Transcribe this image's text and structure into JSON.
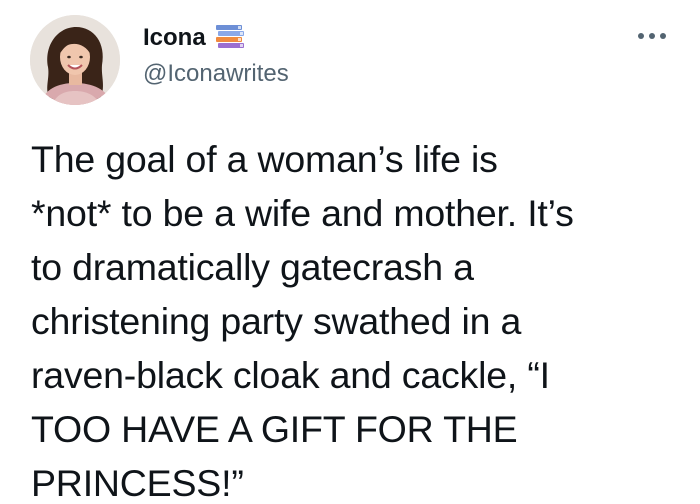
{
  "author": {
    "display_name": "Icona",
    "handle": "@Iconawrites",
    "name_badge_icon": "books-stack-icon",
    "avatar_icon": "profile-photo"
  },
  "menu": {
    "icon": "more-horizontal-icon"
  },
  "tweet": {
    "lines": [
      "The goal of a woman’s life is",
      "*not* to be a wife and mother. It’s",
      "to dramatically gatecrash a",
      "christening party swathed in a",
      "raven-black cloak and cackle, “I",
      "TOO HAVE A GIFT FOR THE",
      "PRINCESS!”"
    ]
  },
  "colors": {
    "text": "#0f1419",
    "secondary_text": "#536471",
    "background": "#ffffff"
  }
}
